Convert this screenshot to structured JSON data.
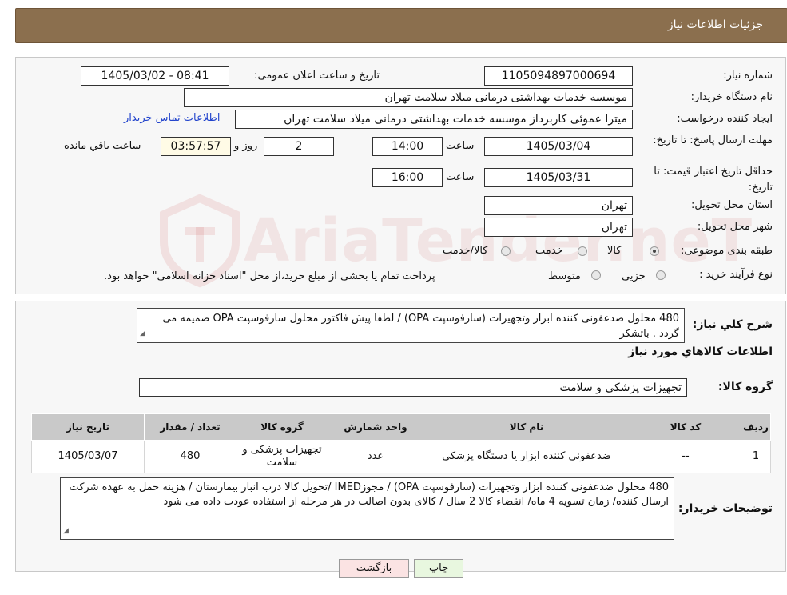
{
  "header": {
    "title": "جزئیات اطلاعات نیاز"
  },
  "form": {
    "need_number_label": "شماره نیاز:",
    "need_number": "1105094897000694",
    "announce_label": "تاریخ و ساعت اعلان عمومی:",
    "announce_value": "1405/03/02 - 08:41",
    "buyer_org_label": "نام دستگاه خریدار:",
    "buyer_org": "موسسه خدمات بهداشتی درمانی میلاد سلامت تهران",
    "requester_label": "ایجاد کننده درخواست:",
    "requester": "میترا عموئی کاربرداز موسسه خدمات بهداشتی درمانی میلاد سلامت تهران",
    "contact_link": "اطلاعات تماس خریدار",
    "deadline_label": "مهلت ارسال پاسخ: تا تاریخ:",
    "deadline_date": "1405/03/04",
    "time_label": "ساعت",
    "deadline_time": "14:00",
    "days_value": "2",
    "days_label": "روز و",
    "remaining_time": "03:57:57",
    "remaining_label": "ساعت باقي مانده",
    "validity_label": "حداقل تاریخ اعتبار قیمت: تا تاریخ:",
    "validity_date": "1405/03/31",
    "validity_time_label": "ساعت",
    "validity_time": "16:00",
    "province_label": "استان محل تحویل:",
    "province": "تهران",
    "city_label": "شهر محل تحویل:",
    "city": "تهران",
    "category_label": "طبقه بندی موضوعی:",
    "category_options": [
      "کالا",
      "خدمت",
      "کالا/خدمت"
    ],
    "category_selected": "کالا",
    "process_label": "نوع فرآیند خرید :",
    "process_options": [
      "جزیی",
      "متوسط"
    ],
    "process_note": "پرداخت تمام یا بخشی از مبلغ خرید،از محل \"اسناد خزانه اسلامی\" خواهد بود."
  },
  "watermark": {
    "text": "AriaTender.neT"
  },
  "description": {
    "label": "شرح کلي نياز:",
    "text": "480 محلول ضدعفونی کننده ابزار وتجهیزات (سارفوسپت OPA) / لطفا پیش فاکتور محلول سارفوسپت OPA ضمیمه می گردد . باتشکر"
  },
  "goods_info_title": "اطلاعات كالاهاي مورد نياز",
  "goods_group": {
    "label": "گروه کالا:",
    "value": "تجهیزات پزشکی و سلامت"
  },
  "table": {
    "headers": [
      "ردیف",
      "کد کالا",
      "نام کالا",
      "واحد شمارش",
      "گروه کالا",
      "تعداد / مقدار",
      "تاریخ نیاز"
    ],
    "rows": [
      [
        "1",
        "--",
        "ضدعفونی کننده ابزار یا دستگاه پزشکی",
        "عدد",
        "تجهیزات پزشکی و سلامت",
        "480",
        "1405/03/07"
      ]
    ]
  },
  "buyer_notes": {
    "label": "توضیحات خریدار:",
    "text": "480 محلول ضدعفونی کننده ابزار وتجهیزات (سارفوسپت OPA) / مجوزIMED /تحویل کالا درب انبار بیمارستان / هزینه حمل به عهده شرکت ارسال کننده/ زمان تسویه 4 ماه/ انقضاء کالا 2 سال / کالای بدون اصالت در هر مرحله از استفاده عودت داده می شود"
  },
  "buttons": {
    "print": "چاپ",
    "back": "بازگشت"
  },
  "colors": {
    "header_bg": "#8b6f4e",
    "print_bg": "#e8f7df",
    "back_bg": "#fbe3e3",
    "link": "#2244cc"
  }
}
